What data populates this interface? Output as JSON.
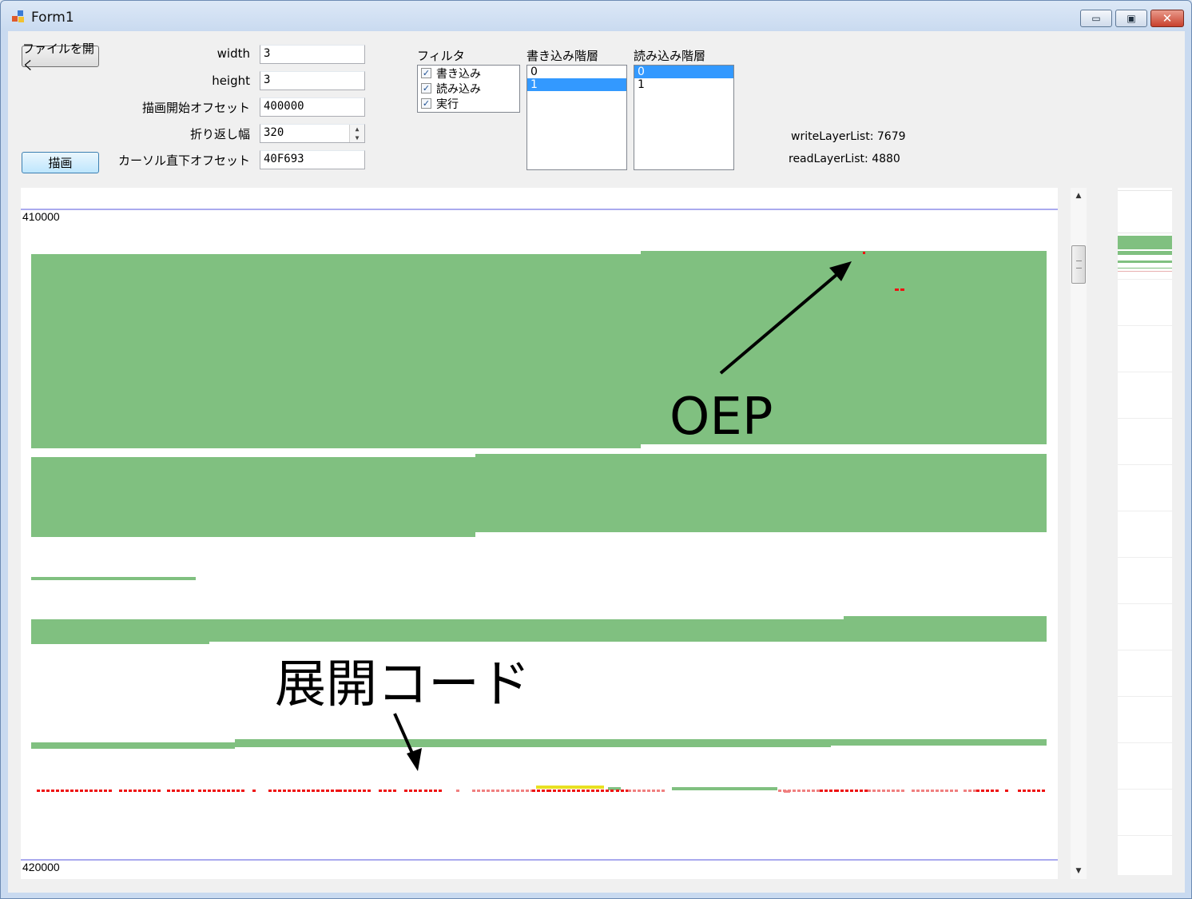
{
  "window": {
    "title": "Form1",
    "minimize_glyph": "▭",
    "maximize_glyph": "▣",
    "close_glyph": "✕"
  },
  "toolbar": {
    "open_file_label": "ファイルを開く",
    "draw_label": "描画"
  },
  "fields": {
    "width_label": "width",
    "width_value": "3",
    "height_label": "height",
    "height_value": "3",
    "draw_offset_label": "描画開始オフセット",
    "draw_offset_value": "400000",
    "wrap_label": "折り返し幅",
    "wrap_value": "320",
    "cursor_label": "カーソル直下オフセット",
    "cursor_value": "40F693"
  },
  "filter": {
    "label": "フィルタ",
    "items": [
      {
        "label": "書き込み",
        "checked": true
      },
      {
        "label": "読み込み",
        "checked": true
      },
      {
        "label": "実行",
        "checked": true
      }
    ]
  },
  "write_layers": {
    "label": "書き込み階層",
    "items": [
      "0",
      "1"
    ],
    "selected": "1"
  },
  "read_layers": {
    "label": "読み込み階層",
    "items": [
      "0",
      "1"
    ],
    "selected": "0"
  },
  "stats": {
    "write_label": "writeLayerList:",
    "write_value": "7679",
    "read_label": "readLayerList:",
    "read_value": "4880"
  },
  "canvas": {
    "start_address": "410000",
    "end_address": "420000",
    "colors": {
      "access": "#80c080",
      "write_mark": "#ee1111",
      "light_mark": "#f08080",
      "yellow_mark": "#e8e020",
      "guide_line": "#aaaaee"
    }
  },
  "annotations": {
    "oep": "OEP",
    "unpack_code": "展開コード"
  }
}
